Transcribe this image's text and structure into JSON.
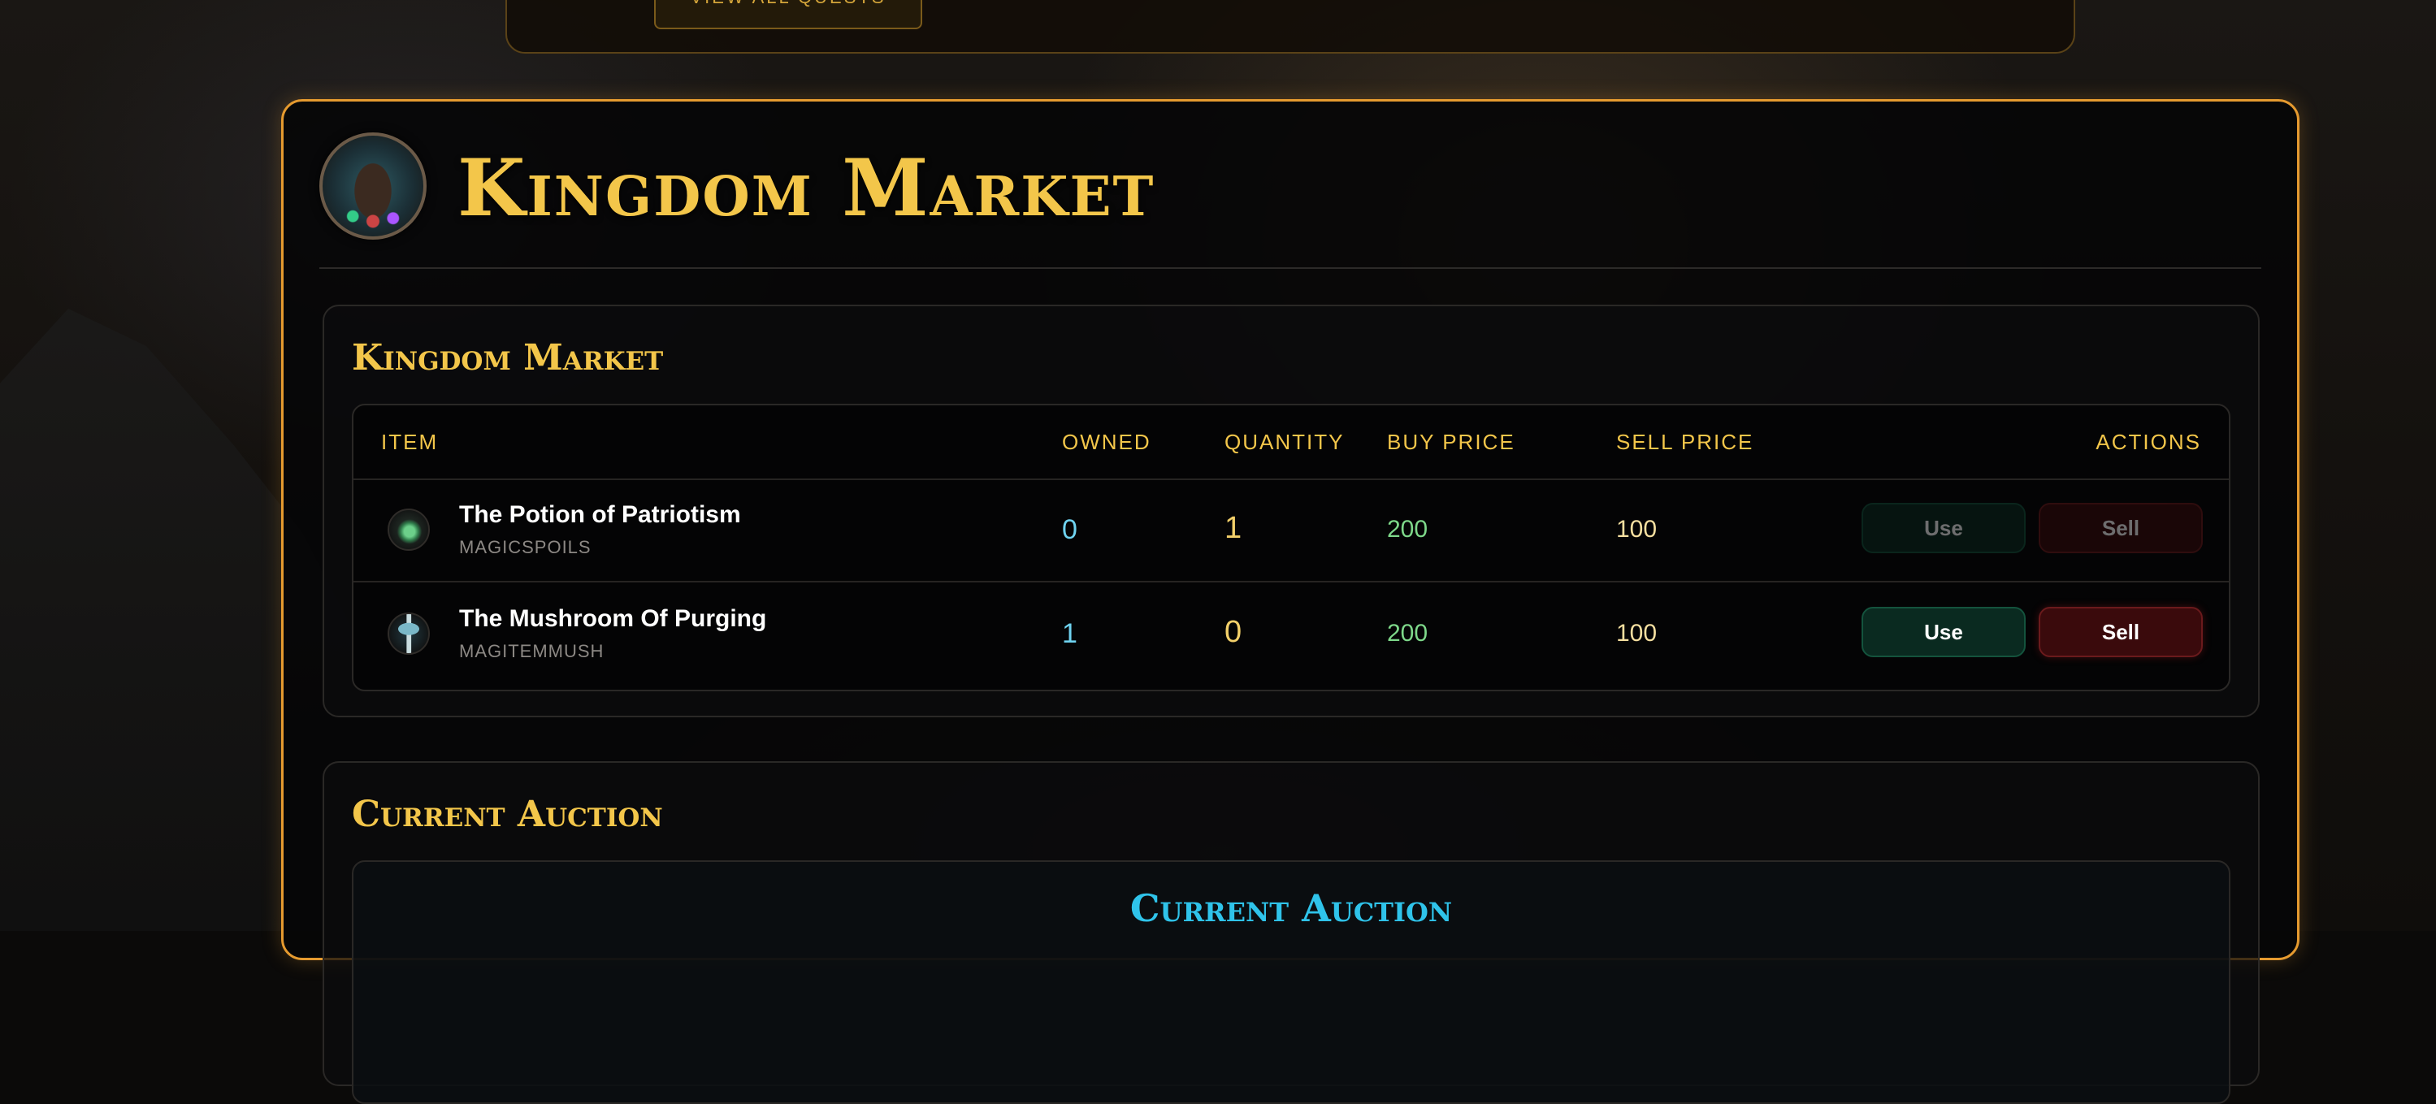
{
  "quests_button": {
    "label": "VIEW ALL QUESTS"
  },
  "header": {
    "title": "Kingdom Market"
  },
  "market": {
    "title": "Kingdom Market",
    "columns": {
      "item": "ITEM",
      "owned": "OWNED",
      "quantity": "QUANTITY",
      "buy_price": "BUY PRICE",
      "sell_price": "SELL PRICE",
      "actions": "ACTIONS"
    },
    "rows": [
      {
        "name": "The Potion of Patriotism",
        "code": "MAGICSPOILS",
        "icon": "potion-icon",
        "owned": "0",
        "quantity": "1",
        "buy_price": "200",
        "sell_price": "100",
        "use_label": "Use",
        "sell_label": "Sell",
        "actions_enabled": false
      },
      {
        "name": "The Mushroom Of Purging",
        "code": "MAGITEMMUSH",
        "icon": "mushroom-icon",
        "owned": "1",
        "quantity": "0",
        "buy_price": "200",
        "sell_price": "100",
        "use_label": "Use",
        "sell_label": "Sell",
        "actions_enabled": true
      }
    ]
  },
  "auction": {
    "title": "Current Auction",
    "inner_title": "Current Auction"
  },
  "colors": {
    "accent_gold": "#f3c64a",
    "border_orange": "#e59a2f",
    "owned_cyan": "#6fd3f0",
    "buy_green": "#7ed88a",
    "auction_cyan": "#2fc3ea"
  }
}
